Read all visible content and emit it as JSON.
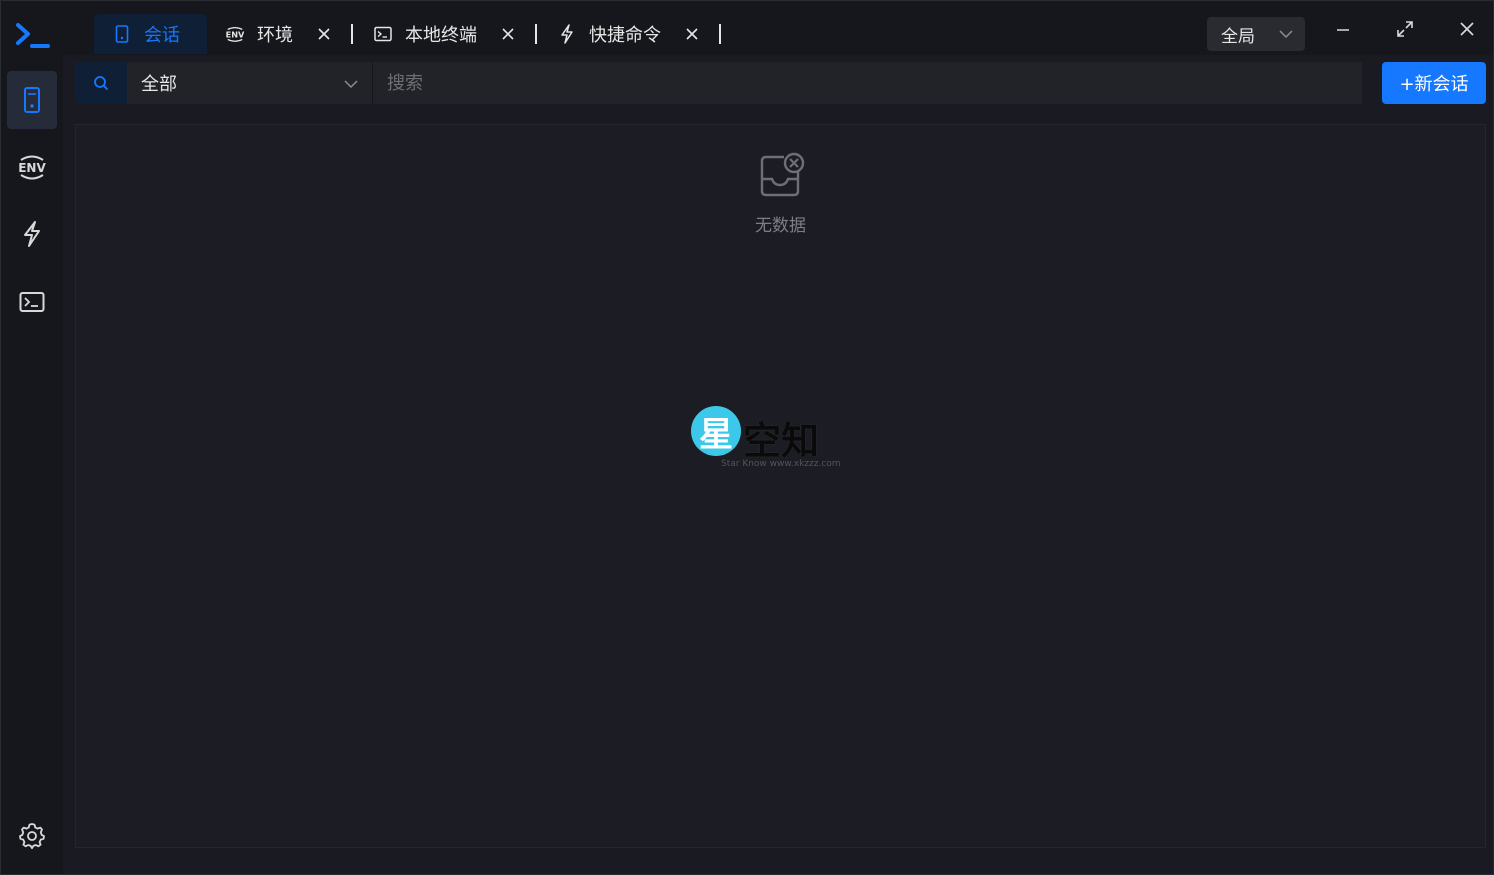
{
  "tabs": [
    {
      "label": "会话",
      "icon": "server-icon",
      "active": true,
      "closable": false
    },
    {
      "label": "环境",
      "icon": "env-icon",
      "active": false,
      "closable": true
    },
    {
      "label": "本地终端",
      "icon": "terminal-icon",
      "active": false,
      "closable": true
    },
    {
      "label": "快捷命令",
      "icon": "lightning-icon",
      "active": false,
      "closable": true
    }
  ],
  "scope": {
    "value": "全局"
  },
  "search": {
    "group_value": "全部",
    "placeholder": "搜索"
  },
  "new_session_label": "+新会话",
  "empty": {
    "text": "无数据"
  },
  "watermark": {
    "main": "星空知",
    "circle_char": "星",
    "rest": "空知",
    "sub": "Star Know www.xkzzz.com"
  },
  "colors": {
    "accent": "#1677ff",
    "background": "#1a1b22",
    "panel": "#1c1d24"
  }
}
